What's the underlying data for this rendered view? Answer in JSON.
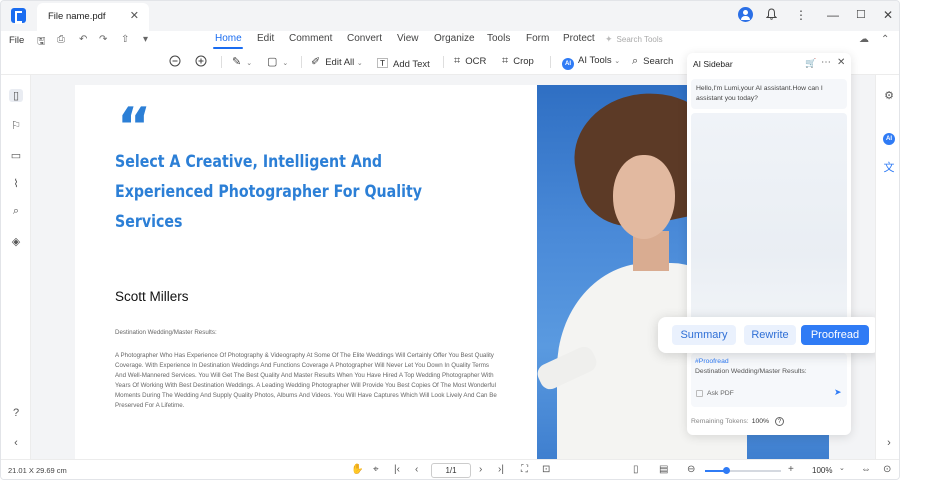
{
  "app": {
    "tab_title": "File name.pdf",
    "brand_color": "#1a6cf0"
  },
  "menubar": {
    "file_label": "File",
    "tabs": [
      "Home",
      "Edit",
      "Comment",
      "Convert",
      "View",
      "Organize",
      "Tools",
      "Form",
      "Protect"
    ],
    "active_tab": "Home",
    "search_placeholder": "Search Tools"
  },
  "toolbar": {
    "edit_all": "Edit All",
    "add_text": "Add Text",
    "ocr": "OCR",
    "crop": "Crop",
    "ai_tools": "AI Tools",
    "ai_badge": "AI",
    "search": "Search"
  },
  "document": {
    "quote_mark": "“",
    "headline": "Select A Creative, Intelligent And Experienced Photographer For Quality Services",
    "author": "Scott Millers",
    "section_label": "Destination Wedding/Master Results:",
    "body": "A Photographer Who Has Experience Of Photography & Videography At Some Of The Elite Weddings Will Certainly Offer You Best Quality Coverage. With Experience In Destination Weddings And Functions Coverage A Photographer Will Never Let You Down In Quality Terms And Well-Mannered Services. You Will Get The Best Quality And Master Results When You Have Hired A Top Wedding Photographer With Years Of Working With Best Destination Weddings. A Leading Wedding Photographer Will Provide You Best Copies Of The Most Wonderful Moments During The Wedding And Supply Quality Photos, Albums And Videos. You Will Have Captures Which Will Look Lively And Can Be Preserved For A Lifetime.",
    "accent_color": "#2c7fd6"
  },
  "ai_sidebar": {
    "title": "AI Sidebar",
    "greeting": "Hello,I'm Lumi,your AI assistant.How can I assistant you today?",
    "input_tag": "#Proofread",
    "input_text": "Destination Wedding/Master Results:",
    "ask_pdf_label": "Ask PDF",
    "ask_pdf_checked": false,
    "tokens_label": "Remaining Tokens:",
    "tokens_value": "100%"
  },
  "actions": {
    "summary": "Summary",
    "rewrite": "Rewrite",
    "proofread": "Proofread",
    "selected": "Proofread"
  },
  "status": {
    "page_size": "21.01 X 29.69 cm",
    "page_indicator": "1/1",
    "zoom_label": "100%",
    "zoom_fraction": 0.28
  },
  "icons": {
    "titlebar": [
      "avatar-icon",
      "bell-icon",
      "more-vertical-icon",
      "minimize-icon",
      "maximize-icon",
      "close-icon"
    ],
    "left_rail": [
      "page-thumbnail-icon",
      "bookmark-icon",
      "comment-icon",
      "attachment-icon",
      "search-icon",
      "layers-icon"
    ],
    "right_rail": [
      "properties-icon",
      "ai-assistant-icon",
      "translate-icon"
    ]
  }
}
